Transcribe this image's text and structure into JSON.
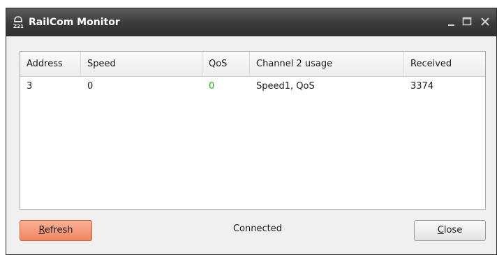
{
  "window": {
    "title": "RailCom Monitor",
    "icon": "z21-app-icon",
    "controls": [
      "minimize-icon",
      "maximize-icon",
      "close-icon"
    ]
  },
  "table": {
    "columns": [
      "Address",
      "Speed",
      "QoS",
      "Channel 2 usage",
      "Received"
    ],
    "rows": [
      {
        "address": "3",
        "speed": "0",
        "qos": "0",
        "channel2": "Speed1, QoS",
        "received": "3374"
      }
    ]
  },
  "qos_color": "#1fb51f",
  "status": "Connected",
  "buttons": {
    "refresh_label": "Refresh",
    "refresh_mnemonic": "R",
    "refresh_rest": "efresh",
    "close_label": "Close",
    "close_mnemonic": "C",
    "close_rest": "lose"
  },
  "colors": {
    "refresh_button": "#f18561",
    "titlebar": "#3a3a3a"
  }
}
